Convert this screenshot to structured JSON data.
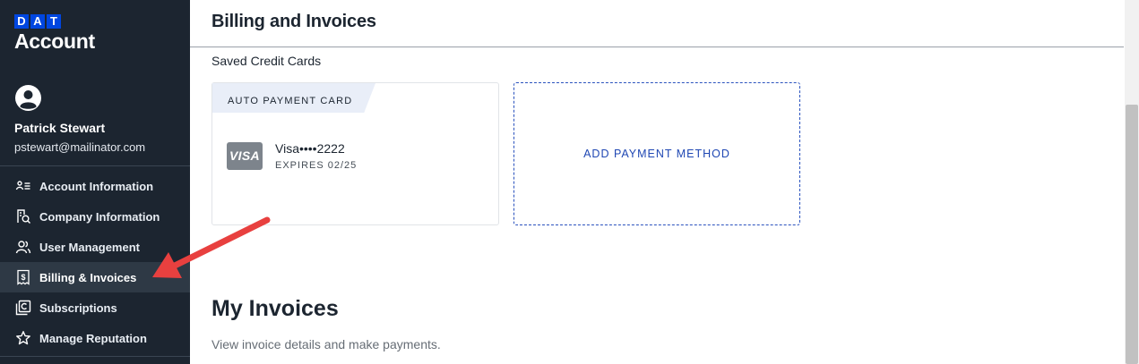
{
  "brand": {
    "logo_letters": [
      "D",
      "A",
      "T"
    ],
    "title": "Account"
  },
  "user": {
    "name": "Patrick Stewart",
    "email": "pstewart@mailinator.com",
    "avatar_icon": "user-circle-icon"
  },
  "nav": {
    "items": [
      {
        "label": "Account Information",
        "icon": "id-card-icon",
        "active": false
      },
      {
        "label": "Company Information",
        "icon": "building-search-icon",
        "active": false
      },
      {
        "label": "User Management",
        "icon": "users-icon",
        "active": false
      },
      {
        "label": "Billing & Invoices",
        "icon": "receipt-dollar-icon",
        "active": true
      },
      {
        "label": "Subscriptions",
        "icon": "subscription-icon",
        "active": false
      },
      {
        "label": "Manage Reputation",
        "icon": "star-icon",
        "active": false
      }
    ]
  },
  "page": {
    "title": "Billing and Invoices",
    "saved_cards_label": "Saved Credit Cards",
    "auto_card": {
      "badge": "AUTO PAYMENT CARD",
      "brand": "VISA",
      "number": "Visa••••2222",
      "expires": "EXPIRES 02/25"
    },
    "add_payment_label": "ADD PAYMENT METHOD",
    "invoices_title": "My Invoices",
    "invoices_subtitle": "View invoice details and make payments."
  },
  "colors": {
    "sidebar_bg": "#1c2530",
    "brand_blue": "#0046e0",
    "link_blue": "#1f47b3",
    "annotation_red": "#e8403f"
  }
}
